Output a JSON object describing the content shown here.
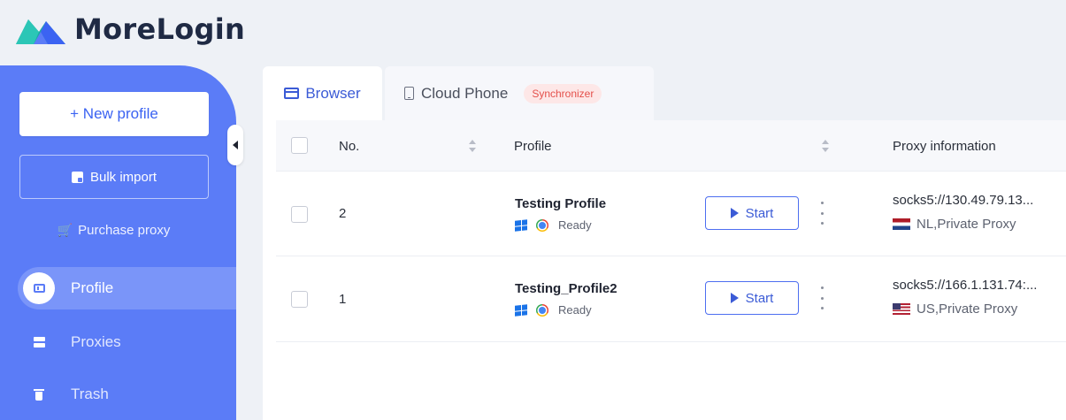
{
  "app": {
    "name": "MoreLogin"
  },
  "sidebar": {
    "new_profile_label": "+ New profile",
    "bulk_import_label": "Bulk import",
    "purchase_proxy_label": "Purchase proxy",
    "nav": [
      {
        "label": "Profile",
        "icon": "profile-icon",
        "active": true
      },
      {
        "label": "Proxies",
        "icon": "proxies-icon",
        "active": false
      },
      {
        "label": "Trash",
        "icon": "trash-icon",
        "active": false
      }
    ]
  },
  "tabs": [
    {
      "label": "Browser",
      "icon": "browser-icon",
      "active": true
    },
    {
      "label": "Cloud Phone",
      "icon": "phone-icon",
      "active": false,
      "badge": "Synchronizer"
    }
  ],
  "table": {
    "columns": {
      "no": "No.",
      "profile": "Profile",
      "proxy": "Proxy information"
    },
    "rows": [
      {
        "no": "2",
        "name": "Testing Profile",
        "status": "Ready",
        "action": "Start",
        "proxy": "socks5://130.49.79.13...",
        "proxy_detail": "NL,Private Proxy",
        "flag": "nl-flag-icon"
      },
      {
        "no": "1",
        "name": "Testing_Profile2",
        "status": "Ready",
        "action": "Start",
        "proxy": "socks5://166.1.131.74:...",
        "proxy_detail": "US,Private Proxy",
        "flag": "us-flag-icon"
      }
    ]
  },
  "colors": {
    "sidebar": "#5b7cf7",
    "accent": "#3b5bd6",
    "badge_bg": "#fde7e7",
    "badge_text": "#e4504b"
  }
}
